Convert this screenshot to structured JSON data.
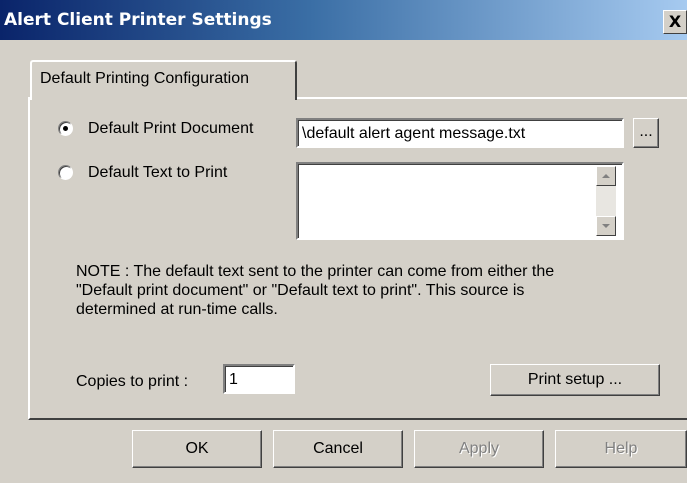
{
  "window": {
    "title": "Alert Client Printer Settings",
    "close_glyph": "X"
  },
  "tabs": [
    {
      "label": "Default Printing Configuration",
      "selected": true
    }
  ],
  "print_source": {
    "document_option": {
      "label": "Default Print Document",
      "selected": true
    },
    "document_path": "\\default alert agent message.txt",
    "browse_label": "...",
    "text_option": {
      "label": "Default Text to Print",
      "selected": false
    },
    "text_value": ""
  },
  "note": {
    "line1": "NOTE : The default text sent to the printer can come from either the",
    "line2": "\"Default print document\" or \"Default text to print\". This source is",
    "line3": "determined at run-time calls."
  },
  "copies": {
    "label": "Copies to print :",
    "value": "1"
  },
  "print_setup_label": "Print setup ...",
  "footer": {
    "ok_label": "OK",
    "cancel_label": "Cancel",
    "apply_label": "Apply",
    "help_label": "Help"
  },
  "icons": {
    "close": "close-icon",
    "scroll_up": "scroll-up-icon",
    "scroll_down": "scroll-down-icon"
  }
}
